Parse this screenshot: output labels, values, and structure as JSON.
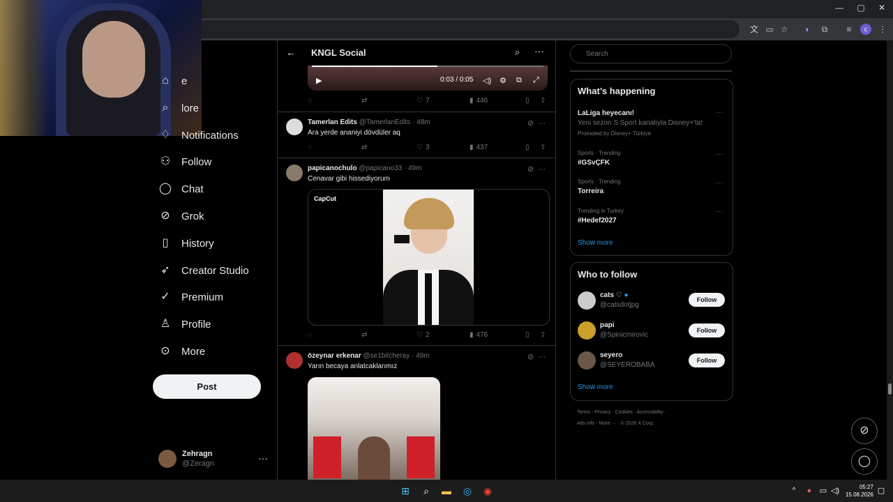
{
  "browser": {
    "url_hint": "s",
    "minimize": "—",
    "maximize": "▢",
    "close": "✕",
    "profile_letter": "c"
  },
  "header": {
    "title": "KNGL Social"
  },
  "nav": {
    "items": [
      {
        "label": "e",
        "icon": "home-icon"
      },
      {
        "label": "lore",
        "icon": "explore-icon"
      },
      {
        "label": "Notifications",
        "icon": "bell-icon"
      },
      {
        "label": "Follow",
        "icon": "follow-icon"
      },
      {
        "label": "Chat",
        "icon": "chat-icon"
      },
      {
        "label": "Grok",
        "icon": "grok-icon"
      },
      {
        "label": "History",
        "icon": "bookmark-icon"
      },
      {
        "label": "Creator Studio",
        "icon": "rocket-icon"
      },
      {
        "label": "Premium",
        "icon": "check-circle-icon"
      },
      {
        "label": "Profile",
        "icon": "person-icon"
      },
      {
        "label": "More",
        "icon": "more-circle-icon"
      }
    ],
    "post_label": "Post"
  },
  "account": {
    "name": "Zehragn",
    "handle": "@Zeragn"
  },
  "video": {
    "time": "0:03 / 0:05"
  },
  "tweets": [
    {
      "actions": {
        "likes": "7",
        "views": "446"
      }
    },
    {
      "author": "Tamerlan Edits",
      "handle": "@TamerlanEdits",
      "time": "· 48m",
      "text": "Ara yerde ananiyi dövdüler aq",
      "actions": {
        "likes": "3",
        "views": "437"
      }
    },
    {
      "author": "papicanochulo",
      "handle": "@papicano33",
      "time": "· 49m",
      "text": "Cenavar gibi hissediyorum",
      "media_label": "CapCut",
      "actions": {
        "likes": "2",
        "views": "476"
      }
    },
    {
      "author": "özeynar erkenar",
      "handle": "@se1bitcheray",
      "time": "· 49m",
      "text": "Yarın becaya anlatcaklarımız"
    }
  ],
  "right": {
    "search_placeholder": "Search",
    "happening_title": "What’s happening",
    "trends": [
      {
        "meta": "",
        "name": "LaLiga heyecanı!",
        "sub": "Yeni sezon S Sport kanalıyla Disney+'ta!",
        "promo": "Promoted by Disney+ Türkiye"
      },
      {
        "meta": "Sports · Trending",
        "name": "#GSvÇFK"
      },
      {
        "meta": "Sports · Trending",
        "name": "Torreira"
      },
      {
        "meta": "Trending in Turkey",
        "name": "#Hedef2027"
      }
    ],
    "show_more": "Show more",
    "wtf_title": "Who to follow",
    "wtf": [
      {
        "name": "cats ♡",
        "handle": "@catsdotjpg",
        "button": "Follow"
      },
      {
        "name": "papi",
        "handle": "@Spinicmirovic",
        "button": "Follow"
      },
      {
        "name": "seyero",
        "handle": "@SEYEROBABA",
        "button": "Follow"
      }
    ],
    "footer1": "Terms  ·  Privacy  ·  Cookies  ·  Accessibility  ·",
    "footer2": "Ads info  ·  More ···  ·  © 2026 X Corp."
  },
  "taskbar": {
    "time": "05:27",
    "date": "15.08.2026"
  },
  "colors": {
    "accent": "#1d9bf0",
    "bg": "#000000",
    "border": "#2f3336"
  }
}
